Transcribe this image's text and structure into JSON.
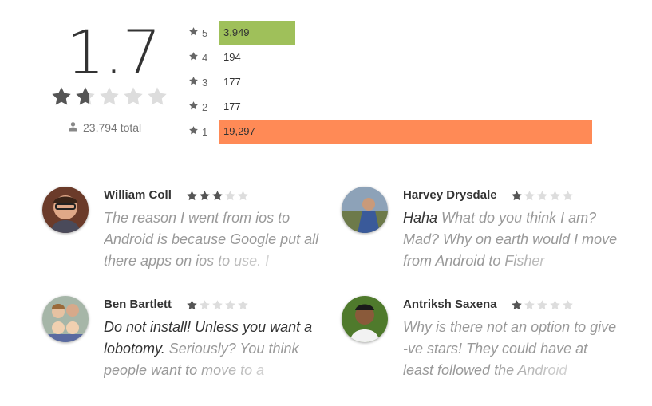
{
  "summary": {
    "score": "1.7",
    "stars_filled": 1.7,
    "total": "23,794 total"
  },
  "histogram": [
    {
      "stars": "5",
      "count": "3,949",
      "color": "#9fc05a"
    },
    {
      "stars": "4",
      "count": "194",
      "color": "#b3d334"
    },
    {
      "stars": "3",
      "count": "177",
      "color": "#ffd54f"
    },
    {
      "stars": "2",
      "count": "177",
      "color": "#ffb234"
    },
    {
      "stars": "1",
      "count": "19,297",
      "color": "#ff8a56"
    }
  ],
  "reviews": [
    {
      "author": "William Coll",
      "rating": 3,
      "strong": "",
      "text": "The reason I went from ios to Android is because Google put all there apps on ios to use. I"
    },
    {
      "author": "Harvey Drysdale",
      "rating": 1,
      "strong": "Haha",
      "text": " What do you think I am? Mad? Why on earth would I move from Android to Fisher"
    },
    {
      "author": "Ben Bartlett",
      "rating": 1,
      "strong": "Do not install! Unless you want a lobotomy.",
      "text": " Seriously? You think people want to move to a"
    },
    {
      "author": "Antriksh Saxena",
      "rating": 1,
      "strong": "",
      "text": "Why is there not an option to give -ve stars! They could have at least followed the Android"
    }
  ],
  "colors": {
    "star_on": "#555555",
    "star_off": "#dddddd"
  }
}
